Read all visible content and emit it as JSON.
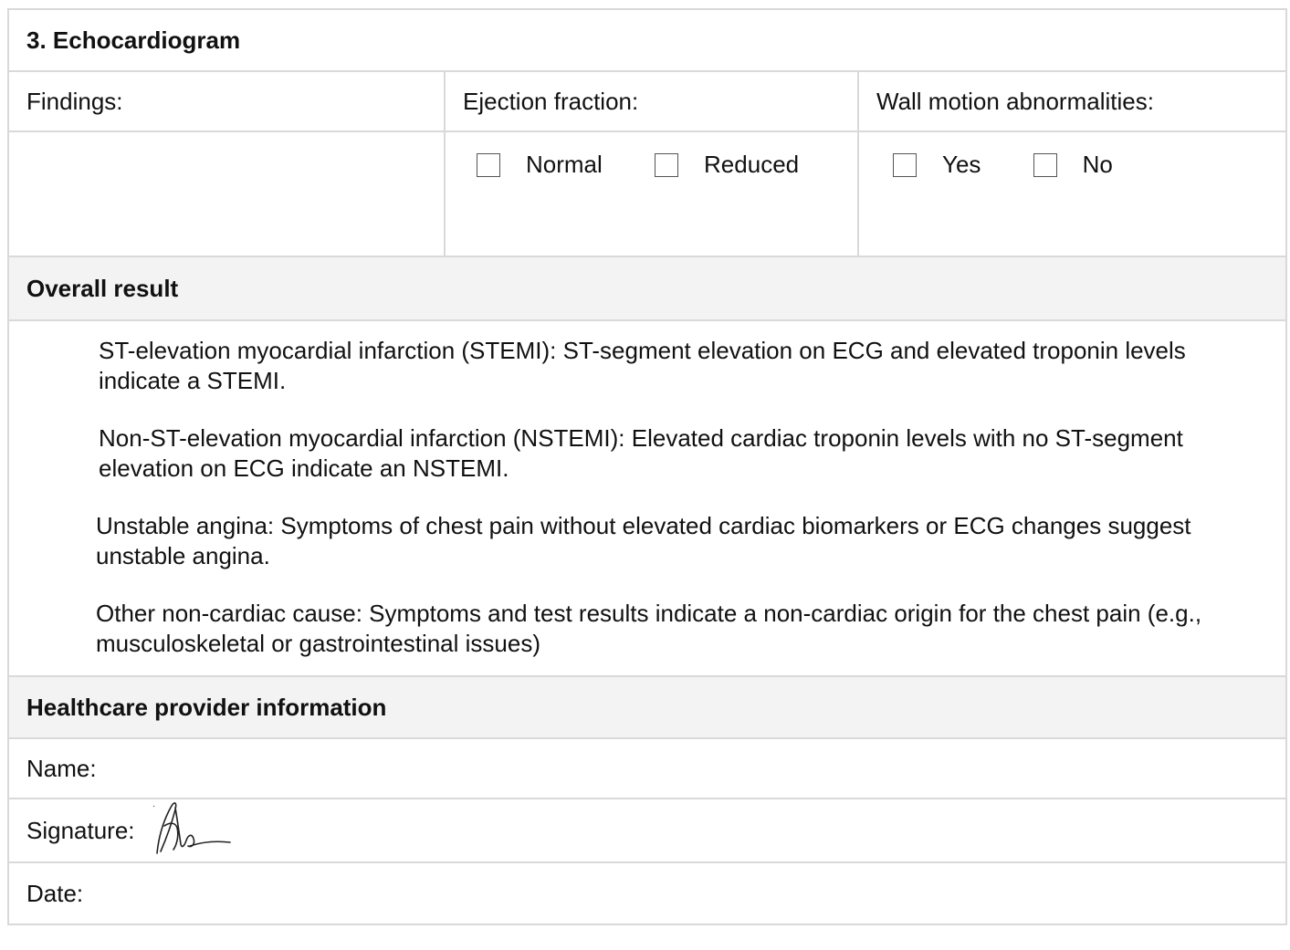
{
  "echo": {
    "heading": "3. Echocardiogram",
    "findings_label": "Findings:",
    "ef_label": "Ejection fraction:",
    "wma_label": "Wall motion abnormalities:",
    "ef_options": [
      "Normal",
      "Reduced"
    ],
    "wma_options": [
      "Yes",
      "No"
    ]
  },
  "overall": {
    "heading": "Overall result",
    "items": [
      "ST-elevation myocardial infarction (STEMI): ST-segment elevation on ECG and elevated troponin levels indicate a STEMI.",
      "Non-ST-elevation myocardial infarction (NSTEMI): Elevated cardiac troponin levels with no ST-segment elevation on ECG indicate an NSTEMI.",
      "Unstable angina: Symptoms of chest pain without elevated cardiac biomarkers or ECG changes suggest unstable angina.",
      "Other non-cardiac cause: Symptoms and test results indicate a non-cardiac origin for the chest pain (e.g., musculoskeletal or gastrointestinal issues)"
    ]
  },
  "provider": {
    "heading": "Healthcare provider information",
    "name_label": "Name:",
    "signature_label": "Signature:",
    "date_label": "Date:"
  }
}
